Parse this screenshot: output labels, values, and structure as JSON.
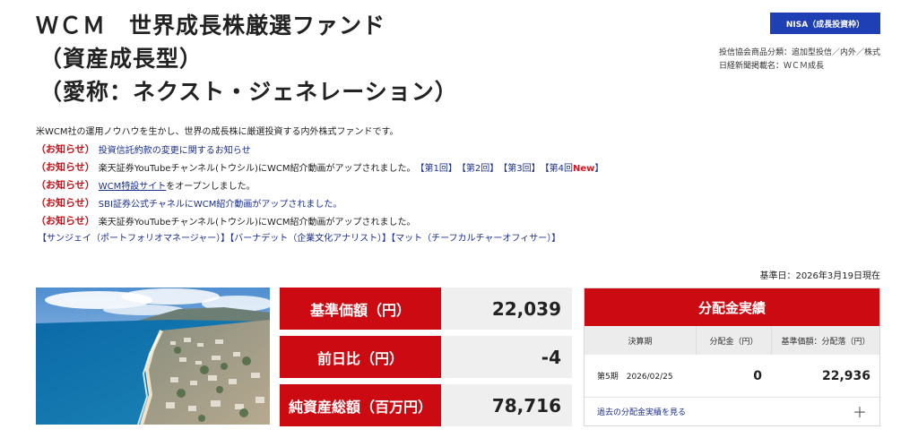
{
  "title": {
    "line1": "ＷＣＭ　世界成長株厳選ファンド",
    "line2": "（資産成長型）",
    "line3": "（愛称：ネクスト・ジェネレーション）"
  },
  "badge": "NISA（成長投資枠）",
  "meta": {
    "category": "投信協会商品分類：追加型投信／内外／株式",
    "nikkei_name": "日経新聞掲載名：ＷＣＭ成長"
  },
  "description": "米WCM社の運用ノウハウを生かし、世界の成長株に厳選投資する内外株式ファンドです。",
  "notice_tag": "（お知らせ）",
  "notices": [
    {
      "text": "投資信託約款の変更に関するお知らせ"
    },
    {
      "text": "楽天証券YouTubeチャンネル(トウシル)にWCM紹介動画がアップされました。",
      "links": [
        "【第1回】",
        "【第2回】",
        "【第3回】",
        "【第4回"
      ],
      "new": "New",
      "close": "】"
    },
    {
      "link": "WCM特設サイト",
      "text": "をオープンしました。"
    },
    {
      "text": "SBI証券公式チャネルにWCM紹介動画がアップされました。"
    },
    {
      "text": "楽天証券YouTubeチャンネル(トウシル)にWCM紹介動画がアップされました。"
    }
  ],
  "sublinks": "【サンジェイ（ポートフォリオマネージャー）】【バーナデット（企業文化アナリスト）】【マット（チーフカルチャーオフィサー）】",
  "as_of": "基準日：2026年3月19日現在",
  "metrics": [
    {
      "label": "基準価額（円）",
      "value": "22,039"
    },
    {
      "label": "前日比（円）",
      "value": "-4"
    },
    {
      "label": "純資産総額（百万円）",
      "value": "78,716"
    }
  ],
  "distribution": {
    "title": "分配金実績",
    "columns": [
      "決算期",
      "分配金（円）",
      "基準価額：分配落（円）"
    ],
    "row": {
      "period": "第5期　2026/02/25",
      "dividend": "0",
      "nav": "22,936"
    },
    "more_link": "過去の分配金実績を見る",
    "more_icon": "plus-icon"
  },
  "colors": {
    "brand_red": "#cc0a12",
    "badge_blue": "#1e40b4",
    "link_blue": "#1a2f8c"
  }
}
